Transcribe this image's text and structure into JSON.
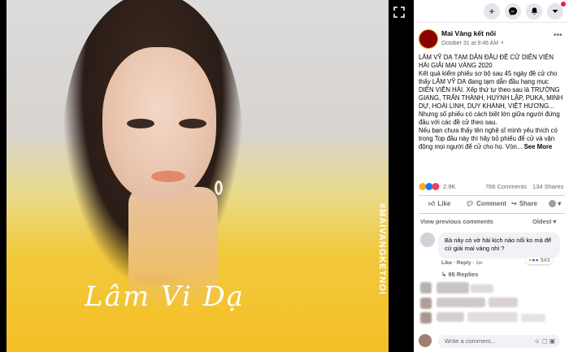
{
  "photo": {
    "signature_text": "Lâm Vi Dạ",
    "hashtag": "#MAIVANGKETNOI"
  },
  "topbar": {
    "buttons": [
      "+",
      "m",
      "bell",
      "caret"
    ]
  },
  "post": {
    "page_name": "Mai Vàng kết nối",
    "timestamp": "October 31 at 9:46 AM",
    "visibility_icon": "globe-icon",
    "paragraphs": [
      "LÂM VỸ DẠ TẠM DẪN ĐẦU ĐỀ CỬ DIỄN VIÊN HÀI GIẢI MAI VÀNG 2020",
      "Kết quả kiểm phiếu sơ bộ sau 45 ngày đề cử cho thấy LÂM VỸ DẠ đang tạm dẫn đầu hạng mục DIỄN VIÊN HÀI. Xếp thứ tự theo sau là TRƯỜNG GIANG, TRẤN THÀNH, HUỲNH LẬP, PUKA, MINH DỰ, HOÀI LINH, DUY KHÁNH, VIỆT HƯƠNG...",
      "Nhưng số phiếu có cách biệt lớn giữa người đứng đầu với các đề cử theo sau.",
      "Nếu bạn chưa thấy tên nghệ sĩ mình yêu thích có trong Top đầu này thì hãy bỏ phiếu để cử và vận động mọi người để cử cho họ. Vòn..."
    ],
    "see_more": "See More",
    "reaction_count": "2.9K",
    "comments_count": "766 Comments",
    "shares_count": "134 Shares",
    "actions": {
      "like": "Like",
      "comment": "Comment",
      "share": "Share"
    }
  },
  "comments": {
    "view_previous": "View previous comments",
    "sort": "Oldest",
    "first": {
      "text": "Bà này có vở hài kịch nào nổi ko mà để cử giải mai vàng nhỉ ?",
      "like": "Like",
      "reply": "Reply",
      "time": "1w",
      "reactions": "543"
    },
    "replies": "95 Replies",
    "write_placeholder": "Write a comment..."
  },
  "colors": {
    "accent": "#1877f2",
    "panel_bg": "#ffffff",
    "bubble_bg": "#f0f2f5",
    "muted_text": "#65676b",
    "photo_yellow": "#f5bf25"
  }
}
